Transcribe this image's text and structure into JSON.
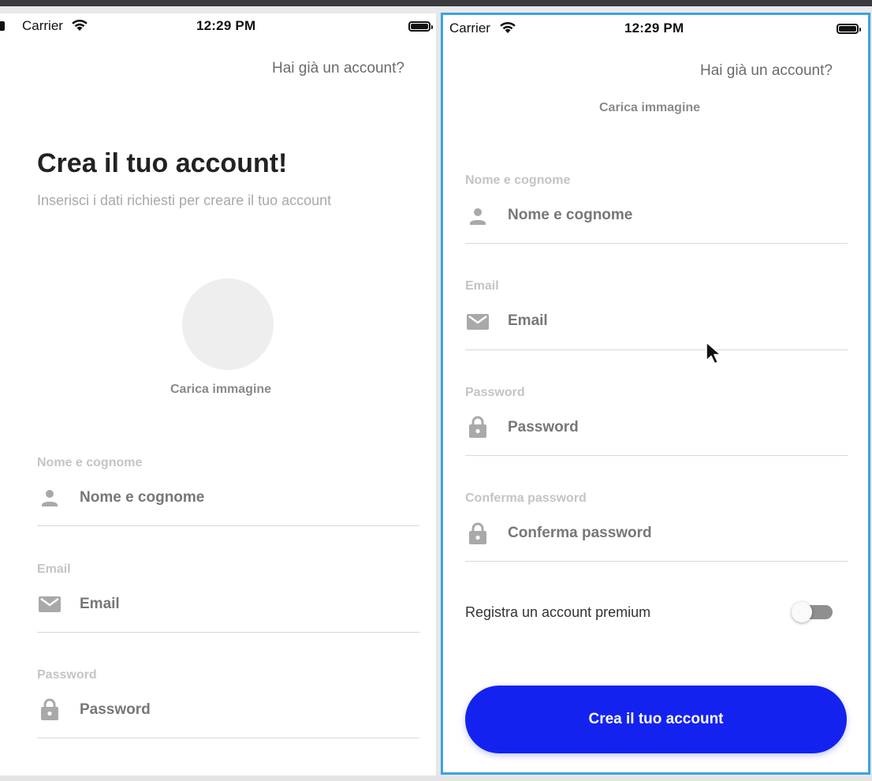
{
  "status_bar": {
    "carrier": "Carrier",
    "time": "12:29 PM"
  },
  "left": {
    "login_link": "Hai già un account?",
    "title": "Crea il tuo account!",
    "subtitle": "Inserisci i dati richiesti per creare il tuo account",
    "upload_label": "Carica immagine",
    "fields": [
      {
        "label": "Nome e cognome",
        "placeholder": "Nome e cognome",
        "icon": "person-icon"
      },
      {
        "label": "Email",
        "placeholder": "Email",
        "icon": "mail-icon"
      },
      {
        "label": "Password",
        "placeholder": "Password",
        "icon": "lock-icon"
      }
    ]
  },
  "right": {
    "login_link": "Hai già un account?",
    "upload_label": "Carica immagine",
    "fields": [
      {
        "label": "Nome e cognome",
        "placeholder": "Nome e cognome",
        "icon": "person-icon"
      },
      {
        "label": "Email",
        "placeholder": "Email",
        "icon": "mail-icon"
      },
      {
        "label": "Password",
        "placeholder": "Password",
        "icon": "lock-icon"
      },
      {
        "label": "Conferma password",
        "placeholder": "Conferma password",
        "icon": "lock-icon"
      }
    ],
    "premium_label": "Registra un account premium",
    "premium_enabled": false,
    "submit_label": "Crea il tuo account"
  },
  "colors": {
    "accent": "#1422f0",
    "selection_border": "#3aa3e0"
  }
}
